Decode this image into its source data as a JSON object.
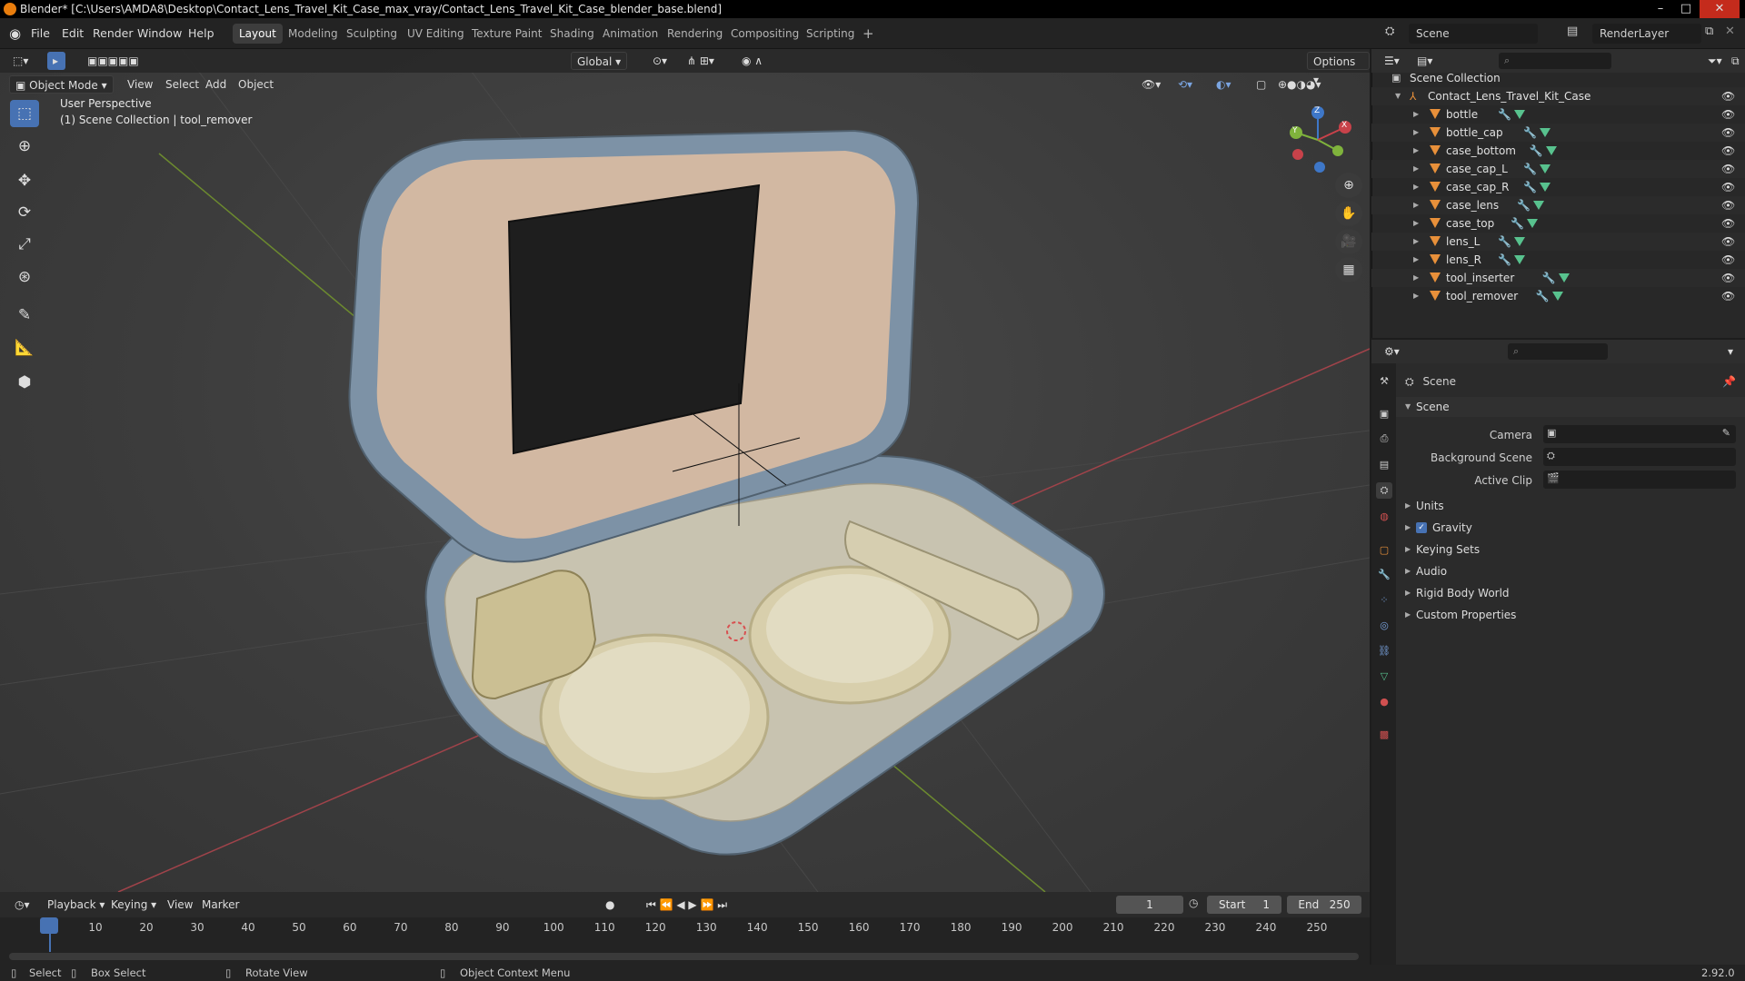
{
  "window": {
    "title": "Blender* [C:\\Users\\AMDA8\\Desktop\\Contact_Lens_Travel_Kit_Case_max_vray/Contact_Lens_Travel_Kit_Case_blender_base.blend]",
    "minimize": "–",
    "maximize": "□",
    "close": "✕"
  },
  "menu": {
    "items": [
      "File",
      "Edit",
      "Render",
      "Window",
      "Help"
    ]
  },
  "workspaces": [
    "Layout",
    "Modeling",
    "Sculpting",
    "UV Editing",
    "Texture Paint",
    "Shading",
    "Animation",
    "Rendering",
    "Compositing",
    "Scripting",
    "+"
  ],
  "topright": {
    "scene_label": "Scene",
    "view_layer_label": "RenderLayer"
  },
  "viewport": {
    "transform_orientation": "Global",
    "options_label": "Options",
    "mode": "Object Mode",
    "header_menus": [
      "View",
      "Select",
      "Add",
      "Object"
    ],
    "overlay_line1": "User Perspective",
    "overlay_line2": "(1) Scene Collection | tool_remover",
    "gizmo_axes": {
      "x": "X",
      "y": "Y",
      "z": "Z"
    }
  },
  "timeline": {
    "menus": [
      "Playback",
      "Keying",
      "View",
      "Marker"
    ],
    "current_frame": "1",
    "start_label": "Start",
    "start_value": "1",
    "end_label": "End",
    "end_value": "250",
    "ticks": [
      "1",
      "10",
      "20",
      "30",
      "40",
      "50",
      "60",
      "70",
      "80",
      "90",
      "100",
      "110",
      "120",
      "130",
      "140",
      "150",
      "160",
      "170",
      "180",
      "190",
      "200",
      "210",
      "220",
      "230",
      "240",
      "250"
    ]
  },
  "statusbar": {
    "select": "Select",
    "box_select": "Box Select",
    "rotate_view": "Rotate View",
    "context_menu": "Object Context Menu",
    "version": "2.92.0"
  },
  "outliner": {
    "root": "Scene Collection",
    "collection": "Contact_Lens_Travel_Kit_Case",
    "objects": [
      "bottle",
      "bottle_cap",
      "case_bottom",
      "case_cap_L",
      "case_cap_R",
      "case_lens",
      "case_top",
      "lens_L",
      "lens_R",
      "tool_inserter",
      "tool_remover"
    ]
  },
  "properties": {
    "context": "Scene",
    "panel_title": "Scene",
    "camera_label": "Camera",
    "background_scene_label": "Background Scene",
    "active_clip_label": "Active Clip",
    "collapsed_panels": [
      "Units",
      "Gravity",
      "Keying Sets",
      "Audio",
      "Rigid Body World",
      "Custom Properties"
    ]
  },
  "colors": {
    "accent": "#4772b3",
    "object_icon": "#e8903a",
    "mesh_icon": "#58c28e",
    "x_axis": "#c8424a",
    "y_axis": "#7fb33c"
  }
}
